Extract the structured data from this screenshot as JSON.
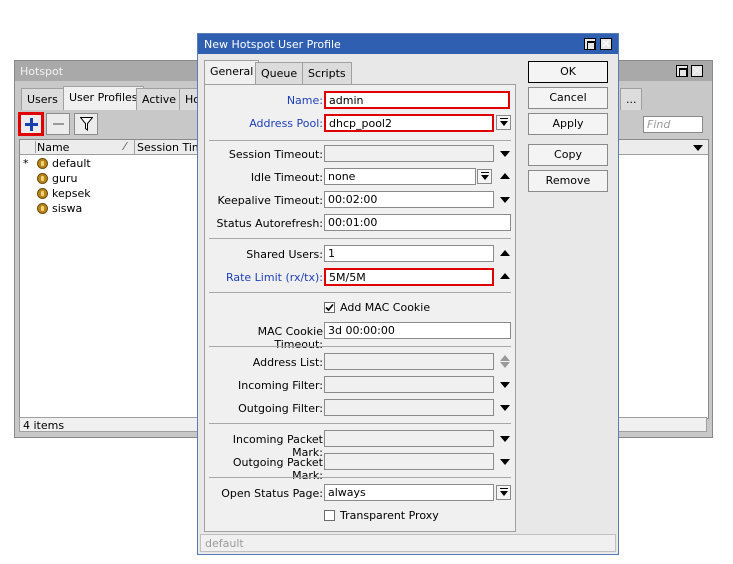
{
  "hotspot": {
    "title": "Hotspot",
    "tabs": [
      "Users",
      "User Profiles",
      "Active",
      "Ho"
    ],
    "find_placeholder": "Find",
    "columns": [
      "Name",
      "Session Time"
    ],
    "rows": [
      {
        "marker": "*",
        "name": "default"
      },
      {
        "marker": "",
        "name": "guru"
      },
      {
        "marker": "",
        "name": "kepsek"
      },
      {
        "marker": "",
        "name": "siswa"
      }
    ],
    "overflow_label": "...",
    "count": "4 items",
    "icons": {
      "add": "plus-icon",
      "remove": "minus-icon",
      "filter": "filter-icon"
    }
  },
  "dialog": {
    "title": "New Hotspot User Profile",
    "tabs": [
      "General",
      "Queue",
      "Scripts"
    ],
    "fields": {
      "name": {
        "label": "Name:",
        "value": "admin"
      },
      "address_pool": {
        "label": "Address Pool:",
        "value": "dhcp_pool2"
      },
      "session_timeout": {
        "label": "Session Timeout:",
        "value": ""
      },
      "idle_timeout": {
        "label": "Idle Timeout:",
        "value": "none"
      },
      "keepalive_timeout": {
        "label": "Keepalive Timeout:",
        "value": "00:02:00"
      },
      "status_autorefresh": {
        "label": "Status Autorefresh:",
        "value": "00:01:00"
      },
      "shared_users": {
        "label": "Shared Users:",
        "value": "1"
      },
      "rate_limit": {
        "label": "Rate Limit (rx/tx):",
        "value": "5M/5M"
      },
      "add_mac_cookie": {
        "label": "Add MAC Cookie",
        "checked": true
      },
      "mac_cookie_timeout": {
        "label": "MAC Cookie Timeout:",
        "value": "3d 00:00:00"
      },
      "address_list": {
        "label": "Address List:",
        "value": ""
      },
      "incoming_filter": {
        "label": "Incoming Filter:",
        "value": ""
      },
      "outgoing_filter": {
        "label": "Outgoing Filter:",
        "value": ""
      },
      "incoming_packet_mark": {
        "label": "Incoming Packet Mark:",
        "value": ""
      },
      "outgoing_packet_mark": {
        "label": "Outgoing Packet Mark:",
        "value": ""
      },
      "open_status_page": {
        "label": "Open Status Page:",
        "value": "always"
      },
      "transparent_proxy": {
        "label": "Transparent Proxy",
        "checked": false
      }
    },
    "buttons": {
      "ok": "OK",
      "cancel": "Cancel",
      "apply": "Apply",
      "copy": "Copy",
      "remove": "Remove"
    },
    "status": "default"
  },
  "colors": {
    "highlight": "#e00000",
    "title_active": "#2f5fb0",
    "label_blue": "#1f3fb8"
  }
}
